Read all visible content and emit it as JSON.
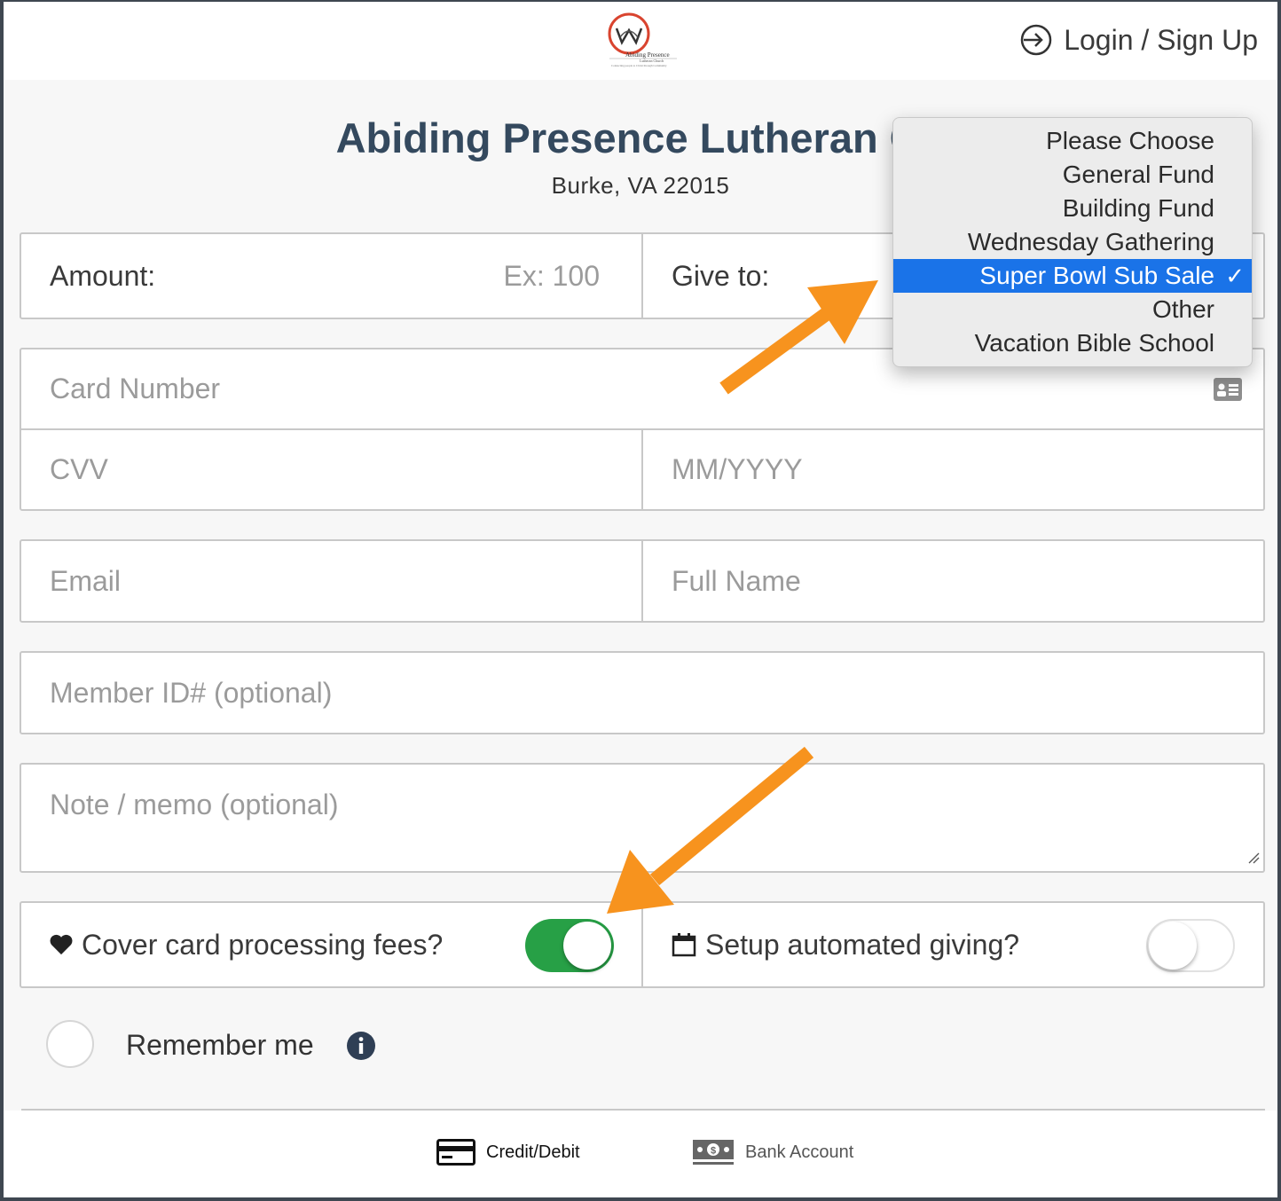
{
  "header": {
    "login_label": "Login / Sign Up",
    "logo_name": "Abiding Presence",
    "logo_sub": "Lutheran Church",
    "logo_tagline": "Connecting people to Christ through Community"
  },
  "church": {
    "name": "Abiding Presence Lutheran Ch",
    "location": "Burke, VA 22015"
  },
  "form": {
    "amount_label": "Amount:",
    "amount_placeholder": "Ex: 100",
    "give_to_label": "Give to:",
    "card_number_placeholder": "Card Number",
    "cvv_placeholder": "CVV",
    "expiry_placeholder": "MM/YYYY",
    "email_placeholder": "Email",
    "full_name_placeholder": "Full Name",
    "member_id_placeholder": "Member ID# (optional)",
    "note_placeholder": "Note / memo (optional)",
    "cover_fees_label": "Cover card processing fees?",
    "cover_fees_on": true,
    "automated_label": "Setup automated giving?",
    "automated_on": false,
    "remember_label": "Remember me"
  },
  "give_to_options": [
    {
      "label": "Please Choose",
      "selected": false
    },
    {
      "label": "General Fund",
      "selected": false
    },
    {
      "label": "Building Fund",
      "selected": false
    },
    {
      "label": "Wednesday Gathering",
      "selected": false
    },
    {
      "label": "Super Bowl Sub Sale",
      "selected": true
    },
    {
      "label": "Other",
      "selected": false
    },
    {
      "label": "Vacation Bible School",
      "selected": false
    }
  ],
  "check_mark": "✓",
  "footer": {
    "credit_label": "Credit/Debit",
    "bank_label": "Bank Account"
  },
  "colors": {
    "title": "#34495e",
    "toggle_on": "#27a046",
    "dropdown_selected": "#1a73e8",
    "annotation_arrow": "#f7931e"
  }
}
